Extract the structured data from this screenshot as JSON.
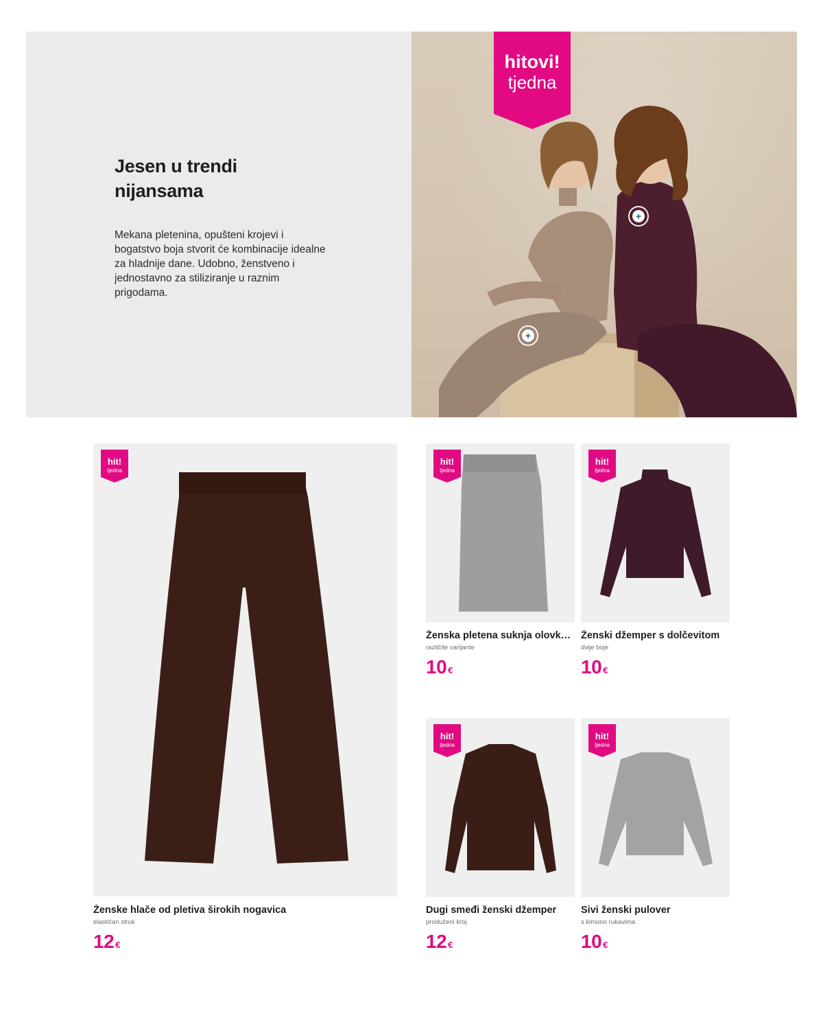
{
  "hero": {
    "title_line1": "Jesen u trendi",
    "title_line2": "nijansama",
    "description": "Mekana pletenina, opušteni krojevi i bogatstvo boja stvorit će kombinacije idealne za hladnije dane. Udobno, ženstveno i jednostavno za stiliziranje u raznim prigodama.",
    "badge_line1": "hitovi!",
    "badge_line2": "tjedna",
    "hotspot_symbol": "+"
  },
  "badge": {
    "line1": "hit!",
    "line2": "tjedna"
  },
  "colors": {
    "accent": "#e10a82",
    "panel": "#ebebeb",
    "card_bg": "#efefef"
  },
  "products": [
    {
      "title": "Ženske hlače od pletiva širokih nogavica",
      "subtitle": "elastičan struk",
      "price": "12",
      "currency": "€",
      "image": "wide-leg-knit-trousers-brown"
    },
    {
      "title": "Ženska pletena suknja olovka ...",
      "subtitle": "različite varijante",
      "price": "10",
      "currency": "€",
      "image": "knit-pencil-skirt-grey"
    },
    {
      "title": "Ženski džemper s dolčevitom",
      "subtitle": "dvije boje",
      "price": "10",
      "currency": "€",
      "image": "turtleneck-sweater-plum"
    },
    {
      "title": "Dugi smeđi ženski džemper",
      "subtitle": "produženi kroj",
      "price": "12",
      "currency": "€",
      "image": "long-sweater-brown"
    },
    {
      "title": "Sivi ženski pulover",
      "subtitle": "s kimono rukavima",
      "price": "10",
      "currency": "€",
      "image": "kimono-sleeve-pullover-grey"
    }
  ]
}
